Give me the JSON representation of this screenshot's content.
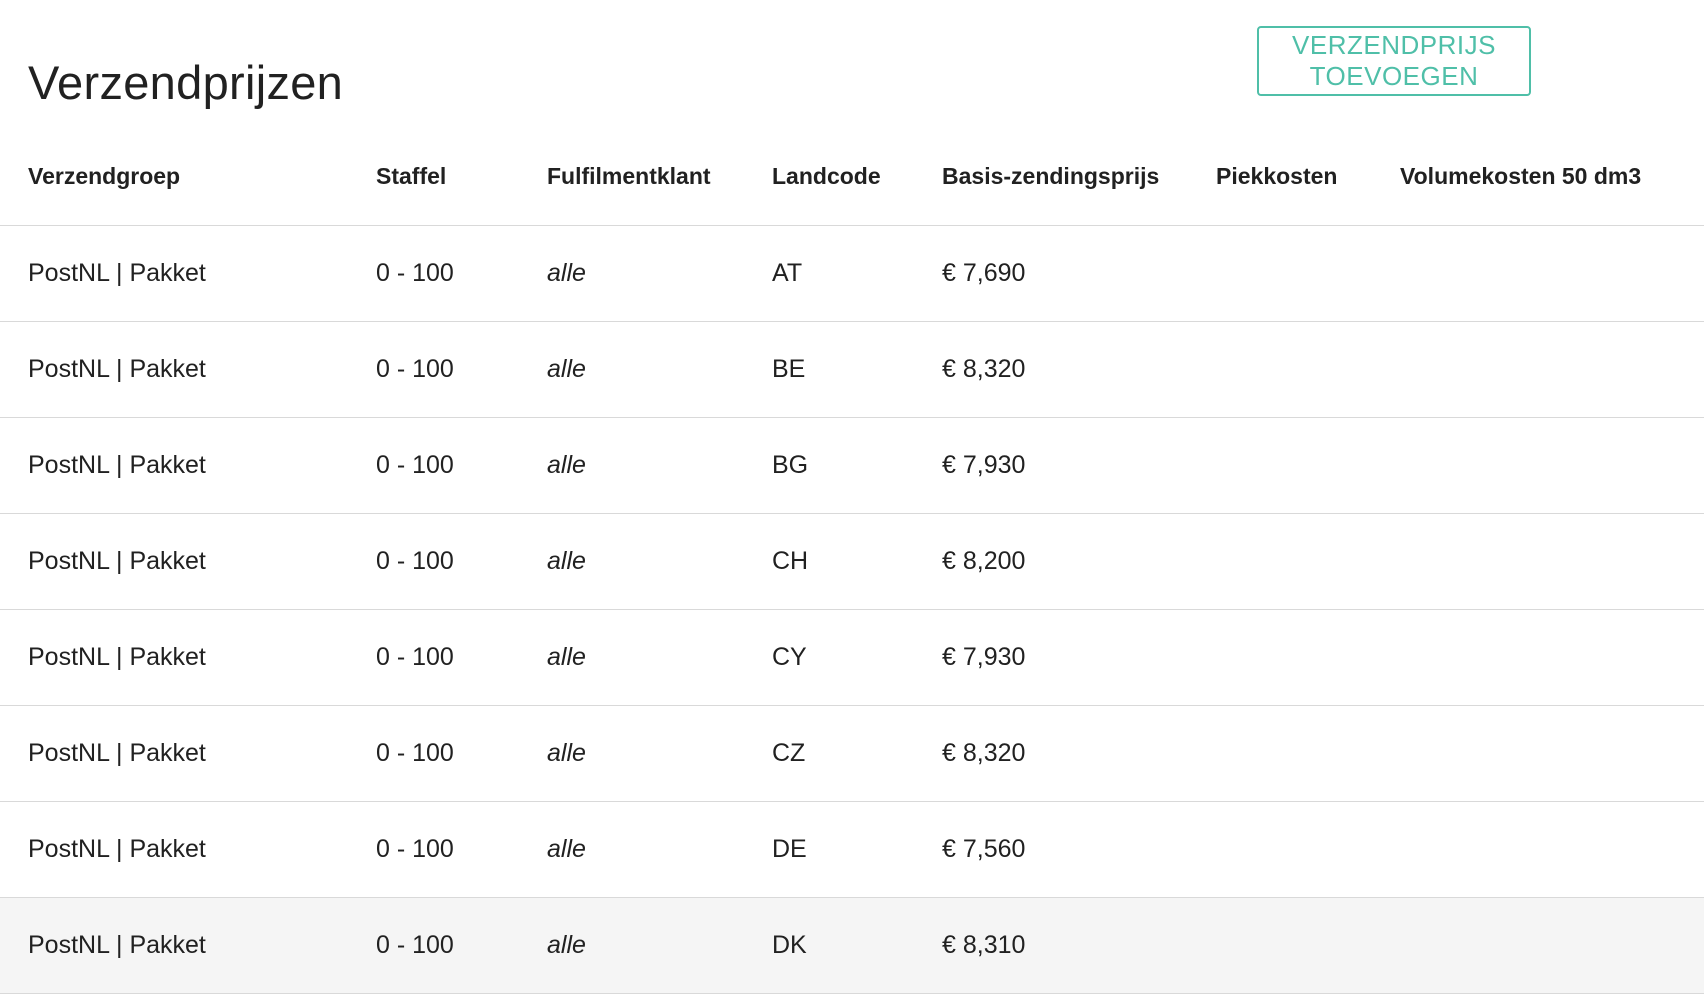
{
  "header": {
    "title": "Verzendprijzen",
    "add_button_label": "VERZENDPRIJS TOEVOEGEN"
  },
  "colors": {
    "accent": "#4fbfa8",
    "row_hover": "#f5f5f5",
    "divider": "#d9d9d9",
    "muted_text": "#a0a0a0"
  },
  "table": {
    "columns": [
      "Verzendgroep",
      "Staffel",
      "Fulfilmentklant",
      "Landcode",
      "Basis-zendingsprijs",
      "Piekkosten",
      "Volumekosten 50 dm3"
    ],
    "rows": [
      {
        "verzendgroep": "PostNL | Pakket",
        "staffel": "0 - 100",
        "klant": "alle",
        "landcode": "AT",
        "basis": "€ 7,690",
        "piek": "",
        "volume": ""
      },
      {
        "verzendgroep": "PostNL | Pakket",
        "staffel": "0 - 100",
        "klant": "alle",
        "landcode": "BE",
        "basis": "€ 8,320",
        "piek": "",
        "volume": ""
      },
      {
        "verzendgroep": "PostNL | Pakket",
        "staffel": "0 - 100",
        "klant": "alle",
        "landcode": "BG",
        "basis": "€ 7,930",
        "piek": "",
        "volume": ""
      },
      {
        "verzendgroep": "PostNL | Pakket",
        "staffel": "0 - 100",
        "klant": "alle",
        "landcode": "CH",
        "basis": "€ 8,200",
        "piek": "",
        "volume": ""
      },
      {
        "verzendgroep": "PostNL | Pakket",
        "staffel": "0 - 100",
        "klant": "alle",
        "landcode": "CY",
        "basis": "€ 7,930",
        "piek": "",
        "volume": ""
      },
      {
        "verzendgroep": "PostNL | Pakket",
        "staffel": "0 - 100",
        "klant": "alle",
        "landcode": "CZ",
        "basis": "€ 8,320",
        "piek": "",
        "volume": ""
      },
      {
        "verzendgroep": "PostNL | Pakket",
        "staffel": "0 - 100",
        "klant": "alle",
        "landcode": "DE",
        "basis": "€ 7,560",
        "piek": "",
        "volume": ""
      },
      {
        "verzendgroep": "PostNL | Pakket",
        "staffel": "0 - 100",
        "klant": "alle",
        "landcode": "DK",
        "basis": "€ 8,310",
        "piek": "",
        "volume": ""
      }
    ]
  }
}
